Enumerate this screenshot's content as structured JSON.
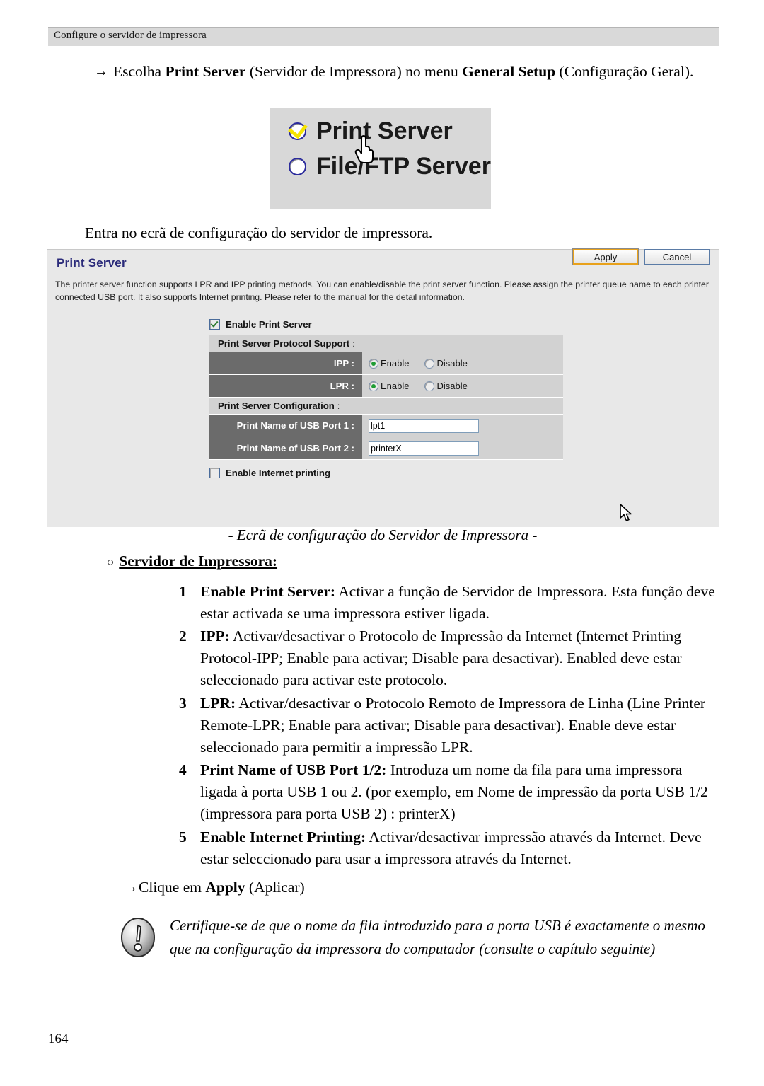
{
  "page": {
    "running_header": "Configure o servidor de impressora",
    "page_number": "164"
  },
  "intro": {
    "arrow": "→",
    "line_html": "Escolha <b>Print Server</b> (Servidor de Impressora) no menu <b>General Setup</b> (Configuração Geral).",
    "enter_screen": "Entra no ecrã de configuração do servidor de impressora."
  },
  "radio_screenshot": {
    "options": [
      {
        "label": "Print Server",
        "selected": true
      },
      {
        "label": "File/FTP Server",
        "selected": false
      }
    ],
    "cursor": "hand-cursor",
    "background_color": "#d8d8d8",
    "check_color": "#f6e400"
  },
  "print_server_panel": {
    "title": "Print Server",
    "description": "The printer server function supports LPR and IPP printing methods. You can enable/disable the print server function. Please assign the printer queue name to each printer connected USB port. It also supports Internet printing. Please refer to the manual for the detail information.",
    "enable_print_server": {
      "label": "Enable Print Server",
      "checked": true
    },
    "protocol_section": {
      "header": "Print Server Protocol Support",
      "colon": ":",
      "rows": [
        {
          "label": "IPP :",
          "options": [
            {
              "label": "Enable",
              "selected": true
            },
            {
              "label": "Disable",
              "selected": false
            }
          ]
        },
        {
          "label": "LPR :",
          "options": [
            {
              "label": "Enable",
              "selected": true
            },
            {
              "label": "Disable",
              "selected": false
            }
          ]
        }
      ]
    },
    "configuration_section": {
      "header": "Print Server Configuration",
      "colon": ":",
      "fields": [
        {
          "label": "Print Name of USB Port 1 :",
          "value": "lpt1",
          "focused": false
        },
        {
          "label": "Print Name of USB Port 2 :",
          "value": "printerX",
          "focused": true
        }
      ]
    },
    "enable_internet_printing": {
      "label": "Enable Internet printing",
      "checked": false
    },
    "buttons": [
      {
        "label": "Apply",
        "focused": true
      },
      {
        "label": "Cancel",
        "focused": false
      }
    ],
    "colors": {
      "panel_background": "#e8e8e8",
      "title": "#2b2b7a",
      "section_header": "#d2d2d2",
      "field_label": "#6b6b6b",
      "radio_selected": "#1f9d35",
      "focus_border": "#e8a11b"
    }
  },
  "figure_caption": "- Ecrã de configuração do Servidor de Impressora -",
  "section": {
    "bullet": "○",
    "heading": "Servidor de Impressora:"
  },
  "numbered_items": [
    {
      "number": "1",
      "term": "Enable Print Server:",
      "text": " Activar a função de Servidor de Impressora. Esta função deve estar activada se uma impressora estiver ligada."
    },
    {
      "number": "2",
      "term": "IPP:",
      "text": " Activar/desactivar o Protocolo de Impressão da Internet (Internet Printing Protocol-IPP; Enable para activar; Disable para desactivar). Enabled deve estar seleccionado para activar este protocolo."
    },
    {
      "number": "3",
      "term": "LPR:",
      "text": " Activar/desactivar o Protocolo Remoto de Impressora de Linha (Line Printer Remote-LPR; Enable para activar; Disable para desactivar). Enable deve estar seleccionado para permitir a impressão LPR."
    },
    {
      "number": "4",
      "term": "Print Name of USB Port 1/2:",
      "text": " Introduza um nome da fila para uma impressora ligada à porta USB 1 ou 2. (por exemplo, em Nome de impressão da porta USB 1/2 (impressora para porta USB 2) : printerX)"
    },
    {
      "number": "5",
      "term": "Enable Internet Printing:",
      "text": " Activar/desactivar impressão através da Internet. Deve estar seleccionado para usar a impressora através da Internet."
    }
  ],
  "apply_line": {
    "arrow": "→",
    "html": "Clique em <b>Apply</b> (Aplicar)"
  },
  "note": {
    "icon": "exclamation-oval-icon",
    "text": "Certifique-se de que o nome da fila introduzido para a porta USB é exactamente o mesmo que na configuração da impressora do computador (consulte o capítulo seguinte)"
  }
}
